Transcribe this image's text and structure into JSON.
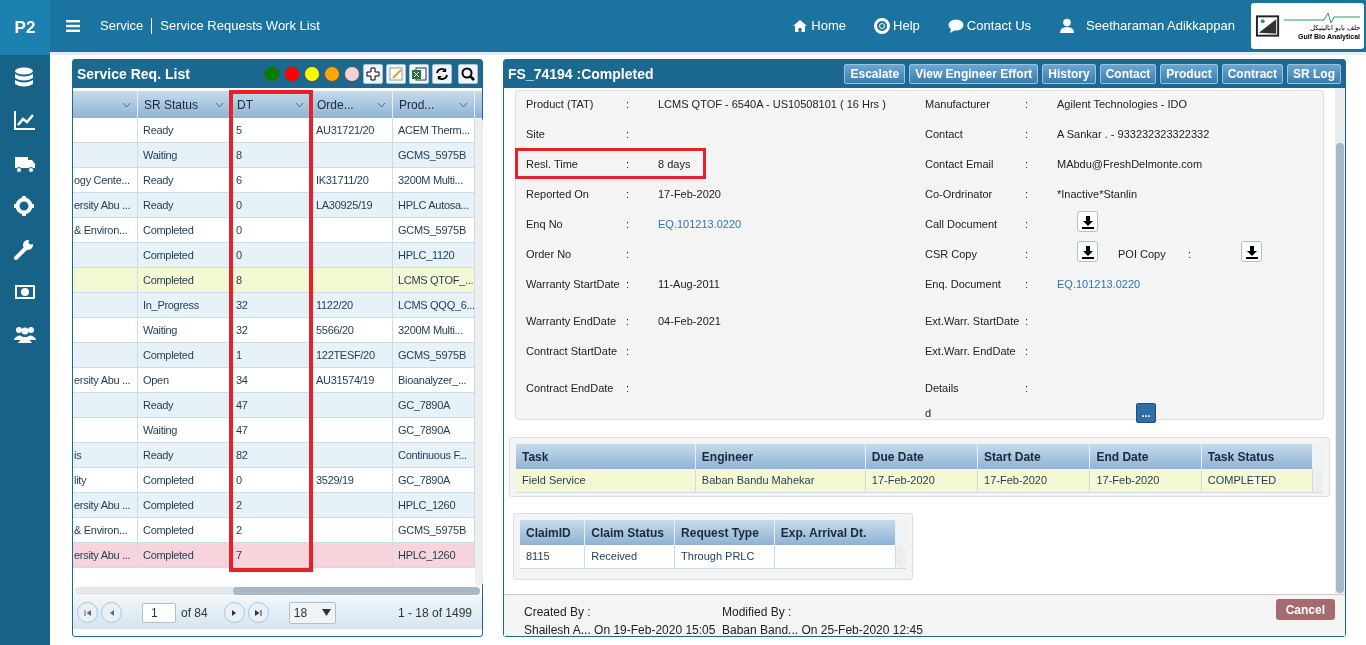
{
  "app": {
    "badge": "P2",
    "breadcrumb": [
      "Service",
      "Service Requests Work List"
    ]
  },
  "top_nav": [
    "Home",
    "Help",
    "Contact Us",
    "Seetharaman Adikkappan"
  ],
  "logo": {
    "arabic": "جلف بايو اناليتيكل",
    "name": "Gulf Bio Analytical"
  },
  "list_panel": {
    "title": "Service Req. List",
    "legend": [
      {
        "color": "#008000"
      },
      {
        "color": "#ff0000"
      },
      {
        "color": "#ffff00"
      },
      {
        "color": "#ffa500"
      },
      {
        "color": "#f5d0d8"
      }
    ],
    "columns": [
      {
        "highlighted": false
      },
      {
        "label": "SR Status",
        "highlighted": false
      },
      {
        "label": "DT",
        "highlighted": true
      },
      {
        "label": "Orde...",
        "highlighted": false
      },
      {
        "label": "Prod...",
        "highlighted": false
      }
    ],
    "rows": [
      {
        "selected": false,
        "cells": [
          null,
          "Ready",
          "5",
          "AU31721/20",
          "ACEM Therm..."
        ]
      },
      {
        "selected": false,
        "cells": [
          null,
          "Waiting",
          "8",
          null,
          "GCMS_5975B"
        ]
      },
      {
        "selected": false,
        "cells": [
          "ogy Cente...",
          "Ready",
          "6",
          "IK31711/20",
          "3200M Multi..."
        ]
      },
      {
        "selected": false,
        "cells": [
          "ersity Abu ...",
          "Ready",
          "0",
          "LA30925/19",
          "HPLC Autosa..."
        ]
      },
      {
        "selected": false,
        "cells": [
          "& Environ...",
          "Completed",
          "0",
          null,
          "GCMS_5975B"
        ]
      },
      {
        "selected": false,
        "cells": [
          null,
          "Completed",
          "0",
          null,
          "HPLC_1120"
        ]
      },
      {
        "selected": true,
        "cells": [
          null,
          "Completed",
          "8",
          null,
          "LCMS QTOF_..."
        ]
      },
      {
        "selected": false,
        "cells": [
          null,
          "In_Progress",
          "32",
          "1122/20",
          "LCMS QQQ_6..."
        ]
      },
      {
        "selected": false,
        "cells": [
          null,
          "Waiting",
          "32",
          "5566/20",
          "3200M Multi..."
        ]
      },
      {
        "selected": false,
        "cells": [
          null,
          "Completed",
          "1",
          "122TESF/20",
          "GCMS_5975B"
        ]
      },
      {
        "selected": false,
        "cells": [
          "ersity Abu ...",
          "Open",
          "34",
          "AU31574/19",
          "Bioanalyzer_..."
        ]
      },
      {
        "selected": false,
        "cells": [
          null,
          "Ready",
          "47",
          null,
          "GC_7890A"
        ]
      },
      {
        "selected": false,
        "cells": [
          null,
          "Waiting",
          "47",
          null,
          "GC_7890A"
        ]
      },
      {
        "selected": false,
        "cells": [
          "is",
          "Ready",
          "82",
          null,
          "Continuous F..."
        ]
      },
      {
        "selected": false,
        "cells": [
          "lity",
          "Completed",
          "0",
          "3529/19",
          "GC_7890A"
        ]
      },
      {
        "selected": false,
        "cells": [
          "ersity Abu ...",
          "Completed",
          "2",
          null,
          "HPLC_1260"
        ]
      },
      {
        "selected": false,
        "cells": [
          "& Environ...",
          "Completed",
          "2",
          null,
          "GCMS_5975B"
        ]
      },
      {
        "selected": false,
        "color": "#f7d3dc",
        "cells": [
          "ersity Abu ...",
          "Completed",
          "7",
          null,
          "HPLC_1260"
        ]
      }
    ],
    "pager": {
      "page": "1",
      "page_count": "of 84",
      "page_size": "18",
      "range": "1 - 18 of 1499"
    }
  },
  "detail_panel": {
    "title": "FS_74194 :Completed",
    "actions": [
      "Escalate",
      "View Engineer Effort",
      "History",
      "Contact",
      "Product",
      "Contract",
      "SR Log"
    ],
    "rows": [
      {
        "left": {
          "label": "Product (TAT)",
          "colon": ":",
          "value": "LCMS QTOF - 6540A - US10508101 ( 16 Hrs )"
        },
        "right": {
          "label": "Manufacturer",
          "colon": ":",
          "value": "Agilent Technologies - IDO"
        }
      },
      {
        "left": {
          "label": "Site",
          "colon": ":"
        },
        "right": {
          "label": "Contact",
          "colon": ":",
          "value": "A Sankar . - 933232323322332"
        }
      },
      {
        "left": {
          "label": "Resl. Time",
          "colon": ":",
          "value": "8 days",
          "highlighted": true
        },
        "right": {
          "label": "Contact Email",
          "colon": ":",
          "value": "MAbdu@FreshDelmonte.com"
        }
      },
      {
        "left": {
          "label": "Reported On",
          "colon": ":",
          "value": "17-Feb-2020"
        },
        "right": {
          "label": "Co-Ordrinator",
          "colon": ":",
          "value": "*Inactive*Stanlin"
        }
      },
      {
        "left": {
          "label": "Enq No",
          "colon": ":",
          "value": "EQ.101213.0220",
          "kind": "link"
        },
        "right": {
          "label": "Call Document",
          "colon": ":",
          "kind": "download"
        }
      },
      {
        "left": {
          "label": "Order No",
          "colon": ":"
        },
        "right": {
          "label": "CSR Copy",
          "colon": ":",
          "kind": "download",
          "second": {
            "label": "POI Copy",
            "colon": ":",
            "kind": "download"
          }
        }
      },
      {
        "left": {
          "label": "Warranty StartDate",
          "colon": ":",
          "value": "11-Aug-2011"
        },
        "right": {
          "label": "Enq. Document",
          "colon": ":",
          "value": "EQ.101213.0220",
          "kind": "link"
        }
      },
      {
        "left": {
          "label": "Warranty EndDate",
          "colon": ":",
          "value": "04-Feb-2021"
        },
        "right": {
          "label": "Ext.Warr. StartDate",
          "colon": ":"
        }
      },
      {
        "left": {
          "label": "Contract StartDate",
          "colon": ":"
        },
        "right": {
          "label": "Ext.Warr. EndDate",
          "colon": ":"
        }
      },
      {
        "left": {
          "label": "Contract EndDate",
          "colon": ":"
        },
        "right": {
          "label": "Details",
          "colon": ":",
          "value": "d",
          "kind": "details",
          "button": "..."
        }
      }
    ],
    "tasks": {
      "columns": [
        "Task",
        "Engineer",
        "Due Date",
        "Start Date",
        "End Date",
        "Task Status"
      ],
      "rows": [
        {
          "selected": true,
          "cells": [
            "Field Service",
            "Baban Bandu Mahekar",
            "17-Feb-2020",
            "17-Feb-2020",
            "17-Feb-2020",
            "COMPLETED"
          ]
        }
      ]
    },
    "claims": {
      "columns": [
        "ClaimID",
        "Claim Status",
        "Request Type",
        "Exp. Arrival Dt."
      ],
      "rows": [
        {
          "cells": [
            "8115",
            "Received",
            "Through PRLC",
            null
          ]
        }
      ]
    },
    "footer": {
      "created_label": "Created By :",
      "created": "Shailesh A... On 19-Feb-2020 15:05",
      "modified_label": "Modified By :",
      "modified": "Baban Band... On 25-Feb-2020 12:45",
      "cancel": "Cancel"
    }
  }
}
